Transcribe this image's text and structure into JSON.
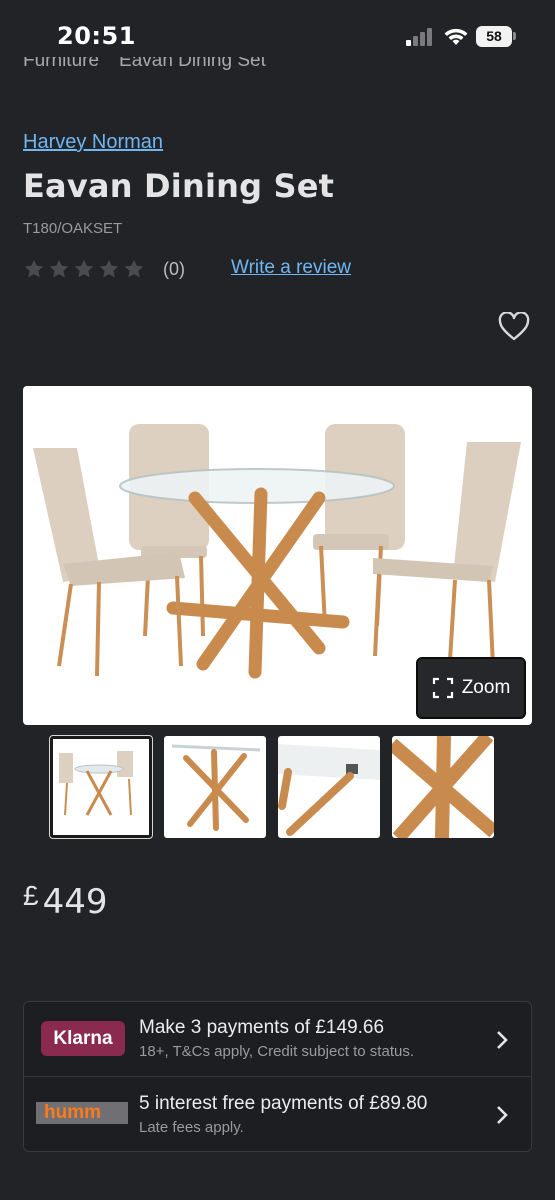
{
  "status_bar": {
    "time": "20:51",
    "battery": "58"
  },
  "breadcrumb": {
    "parent": "Furniture",
    "current": "Eavan Dining Set"
  },
  "product": {
    "brand": "Harvey Norman",
    "title": "Eavan Dining Set",
    "sku": "T180/OAKSET",
    "rating": {
      "stars": 0,
      "max": 5,
      "count_text": "(0)"
    },
    "write_review": "Write a review"
  },
  "gallery": {
    "zoom_label": "Zoom",
    "thumbnail_count": 4,
    "active_thumbnail": 1
  },
  "price": {
    "currency": "£",
    "amount": "449"
  },
  "payments": [
    {
      "provider_logo": "Klarna",
      "title": "Make 3 payments of £149.66",
      "subtitle": "18+, T&Cs apply, Credit subject to status."
    },
    {
      "provider_logo": "humm",
      "title": "5 interest free payments of £89.80",
      "subtitle": "Late fees apply."
    }
  ],
  "colors": {
    "background": "#222326",
    "link": "#6fb6f3",
    "klarna": "#8a2a4f",
    "humm": "#ff7a1a"
  }
}
